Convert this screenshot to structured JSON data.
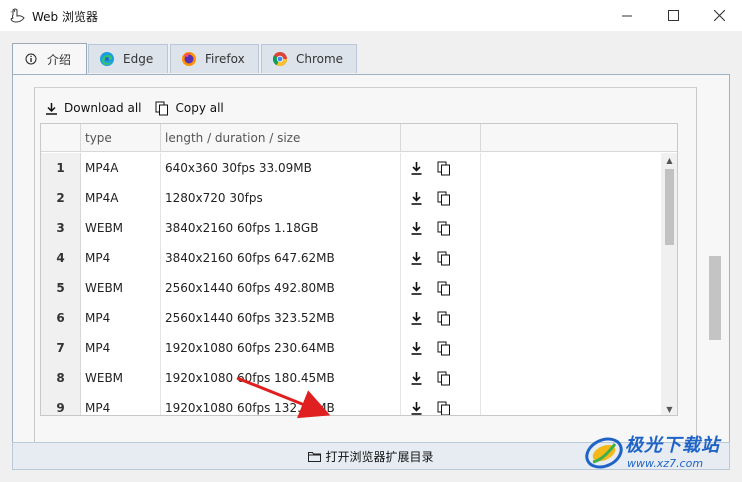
{
  "window": {
    "title": "Web 浏览器",
    "minimize": "—",
    "maximize": "☐",
    "close": "✕"
  },
  "tabs": [
    {
      "label": "介绍",
      "icon": "info-icon",
      "active": true
    },
    {
      "label": "Edge",
      "icon": "edge-icon"
    },
    {
      "label": "Firefox",
      "icon": "firefox-icon"
    },
    {
      "label": "Chrome",
      "icon": "chrome-icon"
    }
  ],
  "toolbar": {
    "download_all": "Download all",
    "copy_all": "Copy all"
  },
  "table": {
    "headers": [
      "",
      "type",
      "length / duration / size",
      "",
      ""
    ],
    "rows": [
      {
        "num": "1",
        "type": "MP4A",
        "info": "640x360 30fps 33.09MB"
      },
      {
        "num": "2",
        "type": "MP4A",
        "info": "1280x720 30fps"
      },
      {
        "num": "3",
        "type": "WEBM",
        "info": "3840x2160 60fps 1.18GB"
      },
      {
        "num": "4",
        "type": "MP4",
        "info": "3840x2160 60fps 647.62MB"
      },
      {
        "num": "5",
        "type": "WEBM",
        "info": "2560x1440 60fps 492.80MB"
      },
      {
        "num": "6",
        "type": "MP4",
        "info": "2560x1440 60fps 323.52MB"
      },
      {
        "num": "7",
        "type": "MP4",
        "info": "1920x1080 60fps 230.64MB"
      },
      {
        "num": "8",
        "type": "WEBM",
        "info": "1920x1080 60fps 180.45MB"
      },
      {
        "num": "9",
        "type": "MP4",
        "info": "1920x1080 60fps 132.43MB"
      }
    ]
  },
  "bottom": {
    "open_ext_dir": "打开浏览器扩展目录"
  },
  "watermark": {
    "name": "极光下载站",
    "url": "www.xz7.com"
  },
  "colors": {
    "accent_blue": "#1e63c5",
    "arrow_red": "#e02020"
  }
}
